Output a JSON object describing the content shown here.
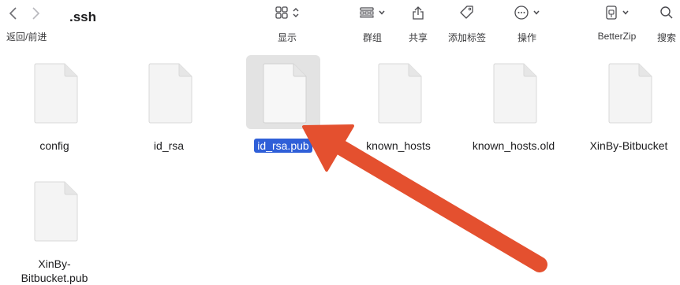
{
  "window": {
    "title": ".ssh"
  },
  "nav": {
    "label": "返回/前进"
  },
  "toolbar": {
    "view_label": "显示",
    "group_label": "群组",
    "share_label": "共享",
    "tags_label": "添加标签",
    "actions_label": "操作",
    "betterzip_label": "BetterZip",
    "search_label": "搜索"
  },
  "files": [
    {
      "name": "config"
    },
    {
      "name": "id_rsa"
    },
    {
      "name": "id_rsa.pub"
    },
    {
      "name": "known_hosts"
    },
    {
      "name": "known_hosts.old"
    },
    {
      "name": "XinBy-Bitbucket"
    },
    {
      "name_line1": "XinBy-",
      "name_line2": "Bitbucket.pub"
    }
  ],
  "selected_file": "id_rsa.pub",
  "colors": {
    "selection": "#2f5fd8",
    "annotation_arrow": "#e4502f"
  }
}
